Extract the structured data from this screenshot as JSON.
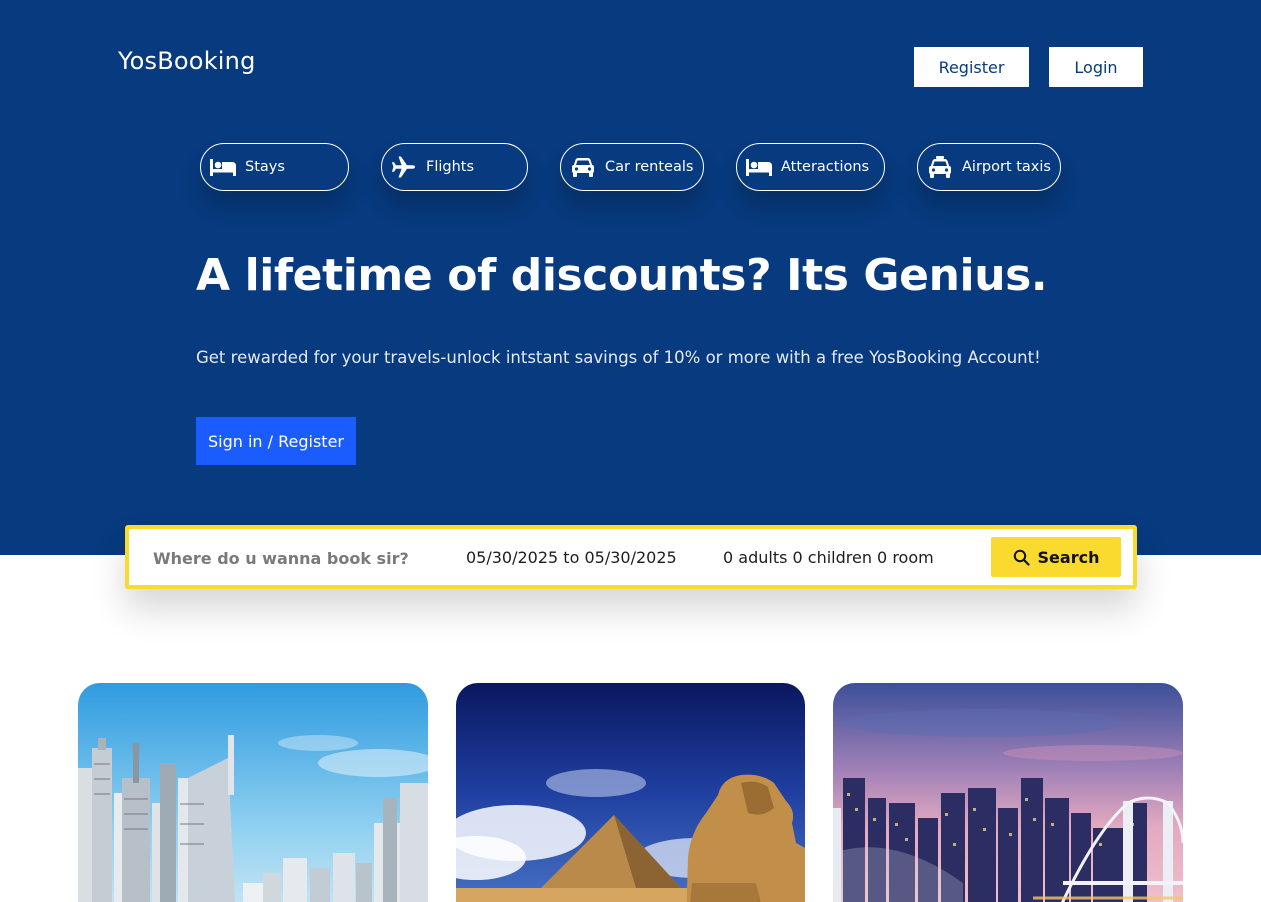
{
  "header": {
    "brand": "YosBooking",
    "register_label": "Register",
    "login_label": "Login"
  },
  "nav": {
    "items": [
      {
        "label": "Stays",
        "icon": "bed-icon"
      },
      {
        "label": "Flights",
        "icon": "plane-icon"
      },
      {
        "label": "Car renteals",
        "icon": "car-icon"
      },
      {
        "label": "Atteractions",
        "icon": "bed-icon"
      },
      {
        "label": "Airport taxis",
        "icon": "taxi-icon"
      }
    ]
  },
  "hero": {
    "headline": "A lifetime of discounts? Its Genius.",
    "subline": "Get rewarded for your travels-unlock intstant savings of 10% or more with a free YosBooking Account!",
    "cta_label": "Sign in / Register"
  },
  "search": {
    "destination_placeholder": "Where do u wanna book sir?",
    "destination_value": "",
    "dates": "05/30/2025 to 05/30/2025",
    "guests": "0 adults 0 children 0 room",
    "button_label": "Search",
    "icon": "search-icon"
  },
  "destinations": [
    {
      "image": "dubai-skyline-photo"
    },
    {
      "image": "egypt-sphinx-pyramid-photo"
    },
    {
      "image": "tokyo-rainbow-bridge-photo"
    }
  ],
  "colors": {
    "hero_bg": "#073A7E",
    "cta_blue": "#1A5CFF",
    "accent_yellow": "#FBDA2F",
    "white": "#FFFFFF"
  }
}
